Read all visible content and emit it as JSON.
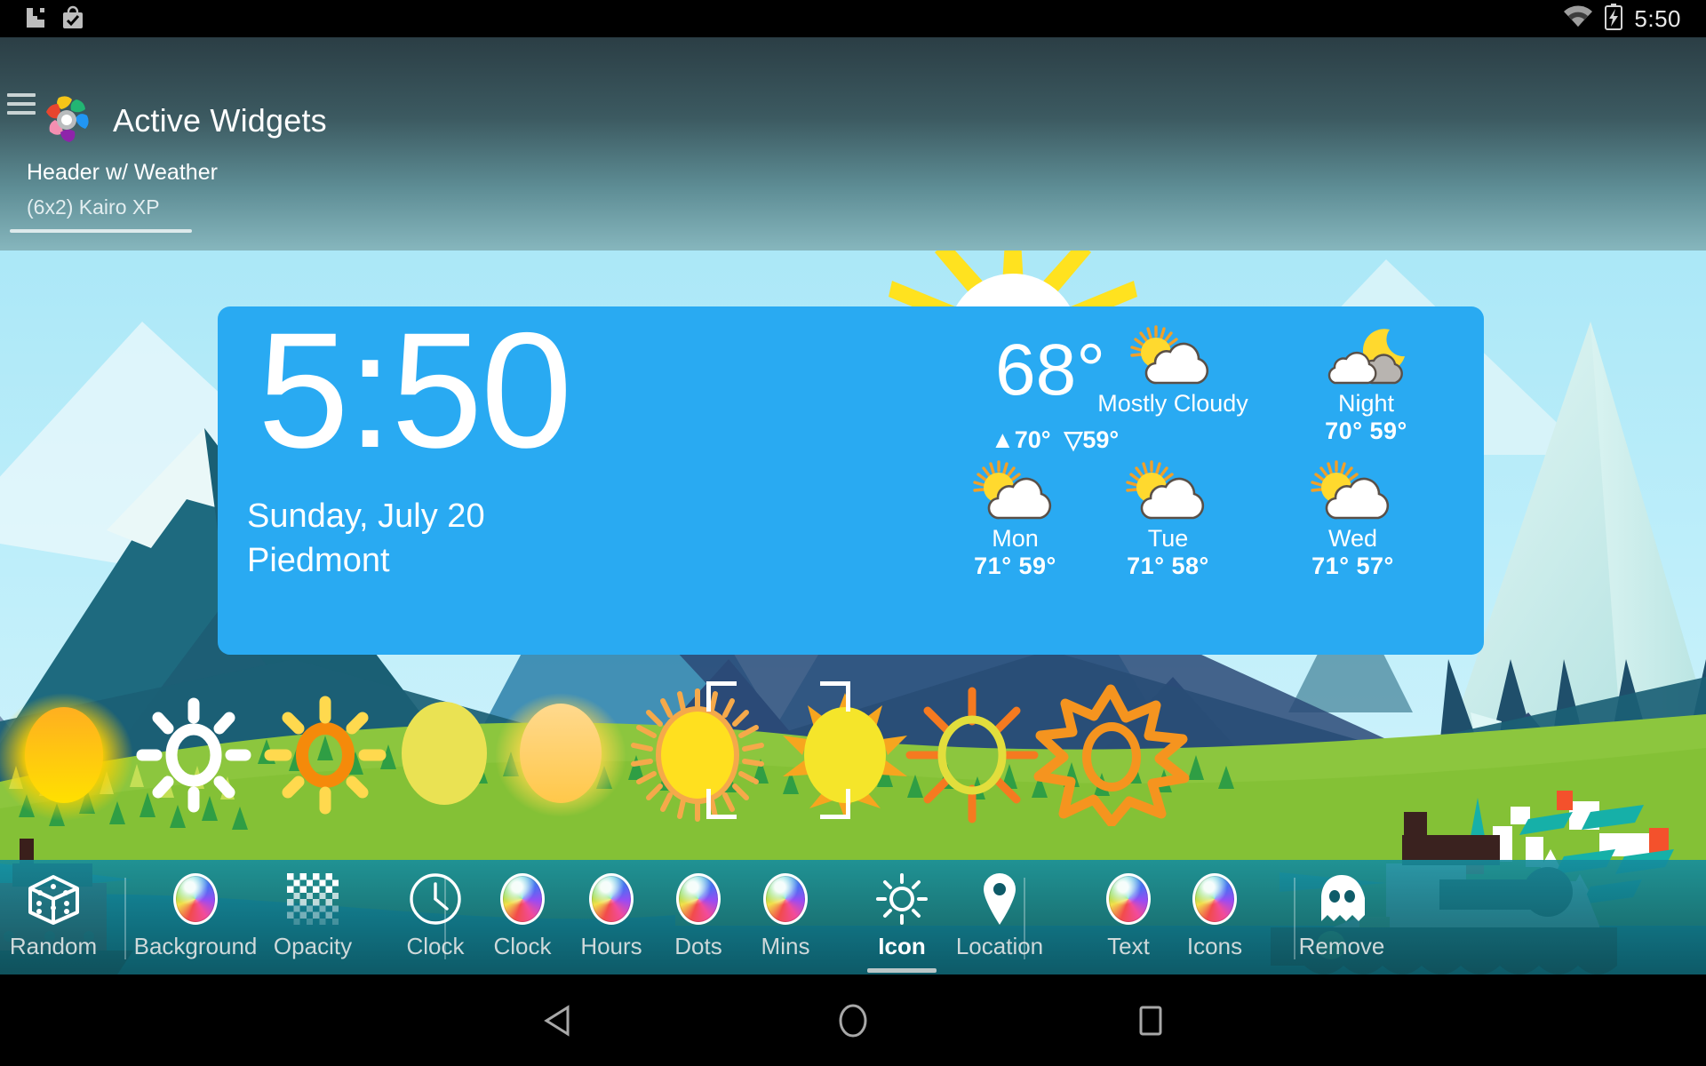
{
  "status_bar": {
    "icons": [
      "image-notification-icon",
      "bag-check-icon",
      "wifi-icon",
      "battery-charging-icon"
    ],
    "time": "5:50"
  },
  "app_bar": {
    "menu_icon": "hamburger-icon",
    "logo_icon": "active-widgets-logo",
    "title": "Active Widgets",
    "widget_name": "Header w/ Weather",
    "widget_size": "(6x2) Kairo XP"
  },
  "widget": {
    "clock": "5:50",
    "date": "Sunday, July 20",
    "city": "Piedmont",
    "current": {
      "temp": "68°",
      "high": "70°",
      "low": "59°",
      "high_arrow": "▲",
      "low_arrow": "▽"
    },
    "forecast": [
      {
        "label": "Mostly Cloudy",
        "icon": "sun-cloud-icon",
        "high": "",
        "low": "",
        "temps": ""
      },
      {
        "label": "Night",
        "icon": "moon-cloud-icon",
        "temps": "70°  59°"
      },
      {
        "label": "Mon",
        "icon": "sun-cloud-icon",
        "temps": "71°  59°"
      },
      {
        "label": "Tue",
        "icon": "sun-cloud-icon",
        "temps": "71°  58°"
      },
      {
        "label": "Wed",
        "icon": "sun-cloud-icon",
        "temps": "71°  57°"
      }
    ],
    "background_color": "#29aaf2",
    "text_color": "#ffffff"
  },
  "icon_chooser": {
    "selected_index": 5,
    "options": [
      {
        "name": "glow-orange-sun-icon"
      },
      {
        "name": "white-outline-sun-icon"
      },
      {
        "name": "orange-ring-sun-icon"
      },
      {
        "name": "flat-yellow-disc-icon"
      },
      {
        "name": "glow-yellow-sun-icon"
      },
      {
        "name": "yellow-sun-rays-icon"
      },
      {
        "name": "yellow-triangle-rays-sun-icon"
      },
      {
        "name": "orange-thin-rays-sun-icon"
      },
      {
        "name": "orange-starburst-outline-sun-icon"
      }
    ]
  },
  "toolbar": {
    "active_item": "Icon",
    "items": [
      {
        "label": "Random",
        "icon": "dice-icon"
      },
      {
        "label": "Background",
        "icon": "color-ball-icon"
      },
      {
        "label": "Opacity",
        "icon": "checkerboard-icon"
      },
      {
        "label": "Clock",
        "icon": "clock-face-icon"
      },
      {
        "label": "Clock",
        "icon": "color-ball-icon"
      },
      {
        "label": "Hours",
        "icon": "color-ball-icon"
      },
      {
        "label": "Dots",
        "icon": "color-ball-icon"
      },
      {
        "label": "Mins",
        "icon": "color-ball-icon"
      },
      {
        "label": "Icon",
        "icon": "sun-icon"
      },
      {
        "label": "Location",
        "icon": "map-pin-icon"
      },
      {
        "label": "Text",
        "icon": "color-ball-icon"
      },
      {
        "label": "Icons",
        "icon": "color-ball-icon"
      },
      {
        "label": "Remove",
        "icon": "ghost-icon"
      }
    ]
  },
  "nav_bar": {
    "back": "back-triangle-icon",
    "home": "home-circle-icon",
    "recents": "recents-square-icon"
  }
}
